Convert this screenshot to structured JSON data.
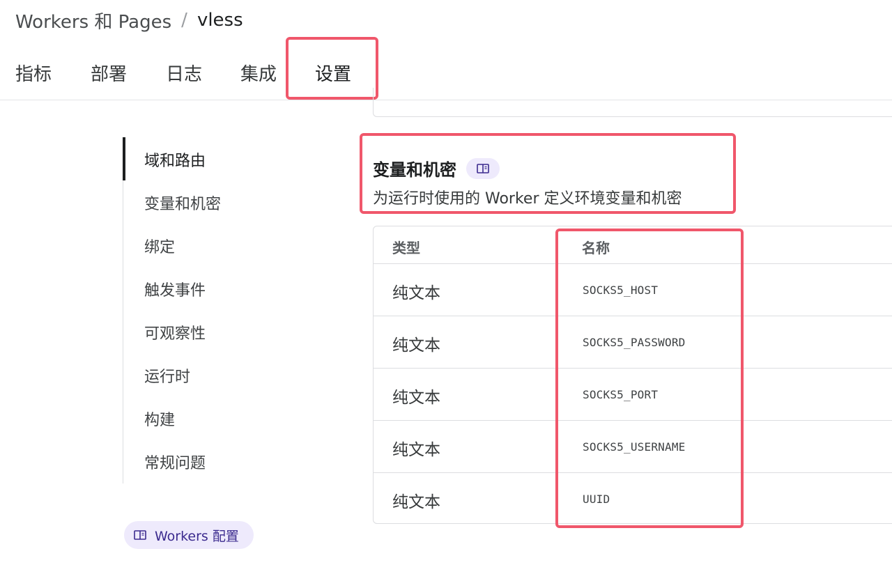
{
  "breadcrumb": {
    "parent": "Workers 和 Pages",
    "separator": "/",
    "current": "vless"
  },
  "tabs": [
    "指标",
    "部署",
    "日志",
    "集成",
    "设置"
  ],
  "active_tab": "设置",
  "sidebar": {
    "items": [
      "域和路由",
      "变量和机密",
      "绑定",
      "触发事件",
      "可观察性",
      "运行时",
      "构建",
      "常规问题"
    ],
    "active": "域和路由",
    "docs_link": "Workers 配置"
  },
  "section": {
    "title": "变量和机密",
    "description": "为运行时使用的 Worker 定义环境变量和机密"
  },
  "table": {
    "headers": {
      "type": "类型",
      "name": "名称"
    },
    "rows": [
      {
        "type": "纯文本",
        "name": "SOCKS5_HOST"
      },
      {
        "type": "纯文本",
        "name": "SOCKS5_PASSWORD"
      },
      {
        "type": "纯文本",
        "name": "SOCKS5_PORT"
      },
      {
        "type": "纯文本",
        "name": "SOCKS5_USERNAME"
      },
      {
        "type": "纯文本",
        "name": "UUID"
      }
    ]
  },
  "colors": {
    "highlight": "#f0576b",
    "docs_pill_bg": "#eeeafc",
    "docs_pill_text": "#3b2a8e"
  },
  "icons": {
    "docs": "book-icon"
  }
}
